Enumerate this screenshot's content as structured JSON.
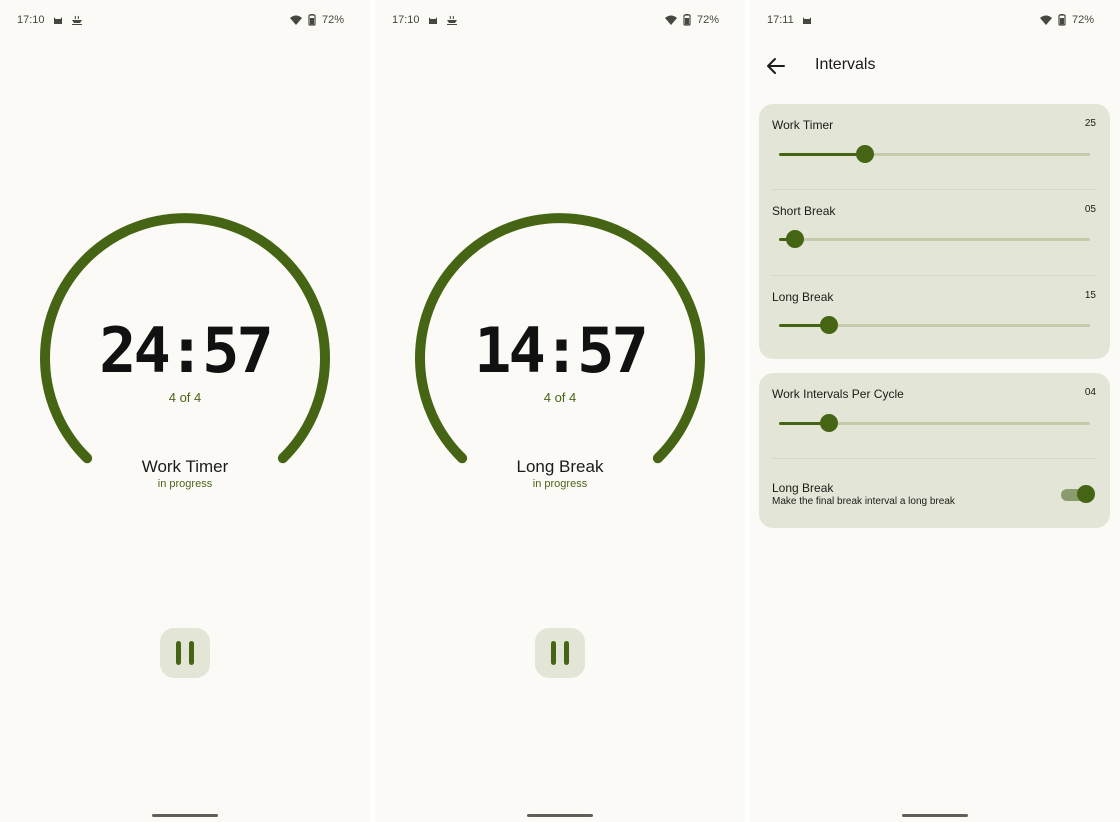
{
  "colors": {
    "accent": "#466514",
    "card": "#e3e5d6",
    "background": "#fbfaf7",
    "track_inactive": "#c3cbaa"
  },
  "screens": [
    {
      "status": {
        "time": "17:10",
        "battery": "72%",
        "icons": [
          "android-cat-icon",
          "coffee-cup-icon",
          "wifi-icon",
          "battery-icon"
        ]
      },
      "timer": {
        "time": "24:57",
        "cycle": "4 of 4",
        "phase": "Work Timer",
        "state": "in progress",
        "remaining_fraction": 0.998
      },
      "pause_button": {
        "icon": "pause-icon"
      }
    },
    {
      "status": {
        "time": "17:10",
        "battery": "72%",
        "icons": [
          "android-cat-icon",
          "coffee-cup-icon",
          "wifi-icon",
          "battery-icon"
        ]
      },
      "timer": {
        "time": "14:57",
        "cycle": "4 of 4",
        "phase": "Long Break",
        "state": "in progress",
        "remaining_fraction": 0.997
      },
      "pause_button": {
        "icon": "pause-icon"
      }
    },
    {
      "status": {
        "time": "17:11",
        "battery": "72%",
        "icons": [
          "android-cat-icon",
          "wifi-icon",
          "battery-icon"
        ]
      },
      "title": "Intervals",
      "back_icon": "arrow-left-icon",
      "sliders": [
        {
          "label": "Work Timer",
          "value": "25",
          "fraction": 0.275
        },
        {
          "label": "Short Break",
          "value": "05",
          "fraction": 0.05
        },
        {
          "label": "Long Break",
          "value": "15",
          "fraction": 0.16
        },
        {
          "label": "Work Intervals Per Cycle",
          "value": "04",
          "fraction": 0.16
        }
      ],
      "toggle": {
        "label": "Long Break",
        "description": "Make the final break interval a long break",
        "checked": true
      }
    }
  ]
}
